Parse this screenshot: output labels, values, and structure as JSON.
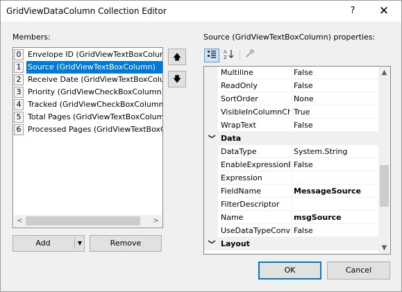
{
  "window": {
    "title": "GridViewDataColumn Collection Editor",
    "help_glyph": "?",
    "close_glyph": "✕"
  },
  "members": {
    "label": "Members:",
    "items": [
      {
        "index": "0",
        "text": "Envelope ID (GridViewTextBoxColumn)"
      },
      {
        "index": "1",
        "text": "Source (GridViewTextBoxColumn)"
      },
      {
        "index": "2",
        "text": "Receive Date (GridViewTextBoxColumn)"
      },
      {
        "index": "3",
        "text": "Priority (GridViewCheckBoxColumn)"
      },
      {
        "index": "4",
        "text": "Tracked (GridViewCheckBoxColumn)"
      },
      {
        "index": "5",
        "text": "Total Pages (GridViewTextBoxColumn)"
      },
      {
        "index": "6",
        "text": "Processed Pages (GridViewTextBoxColumn)"
      }
    ],
    "selected_index": 1,
    "add_label": "Add",
    "remove_label": "Remove",
    "up_glyph": "🡅",
    "down_glyph": "🡇"
  },
  "properties": {
    "label": "Source (GridViewTextBoxColumn) properties:",
    "rows": [
      {
        "kind": "prop",
        "name": "Multiline",
        "value": "False",
        "bold": false
      },
      {
        "kind": "prop",
        "name": "ReadOnly",
        "value": "False",
        "bold": false
      },
      {
        "kind": "prop",
        "name": "SortOrder",
        "value": "None",
        "bold": false
      },
      {
        "kind": "prop",
        "name": "VisibleInColumnChooser",
        "value": "True",
        "bold": false
      },
      {
        "kind": "prop",
        "name": "WrapText",
        "value": "False",
        "bold": false
      },
      {
        "kind": "cat",
        "name": "Data"
      },
      {
        "kind": "prop",
        "name": "DataType",
        "value": "System.String",
        "bold": false
      },
      {
        "kind": "prop",
        "name": "EnableExpressionEditor",
        "value": "False",
        "bold": false
      },
      {
        "kind": "prop",
        "name": "Expression",
        "value": "",
        "bold": false
      },
      {
        "kind": "prop",
        "name": "FieldName",
        "value": "MessageSource",
        "bold": true
      },
      {
        "kind": "prop",
        "name": "FilterDescriptor",
        "value": "",
        "bold": false
      },
      {
        "kind": "prop",
        "name": "Name",
        "value": "msgSource",
        "bold": true
      },
      {
        "kind": "prop",
        "name": "UseDataTypeConverter",
        "value": "False",
        "bold": false
      },
      {
        "kind": "cat",
        "name": "Layout"
      }
    ]
  },
  "footer": {
    "ok_label": "OK",
    "cancel_label": "Cancel"
  }
}
